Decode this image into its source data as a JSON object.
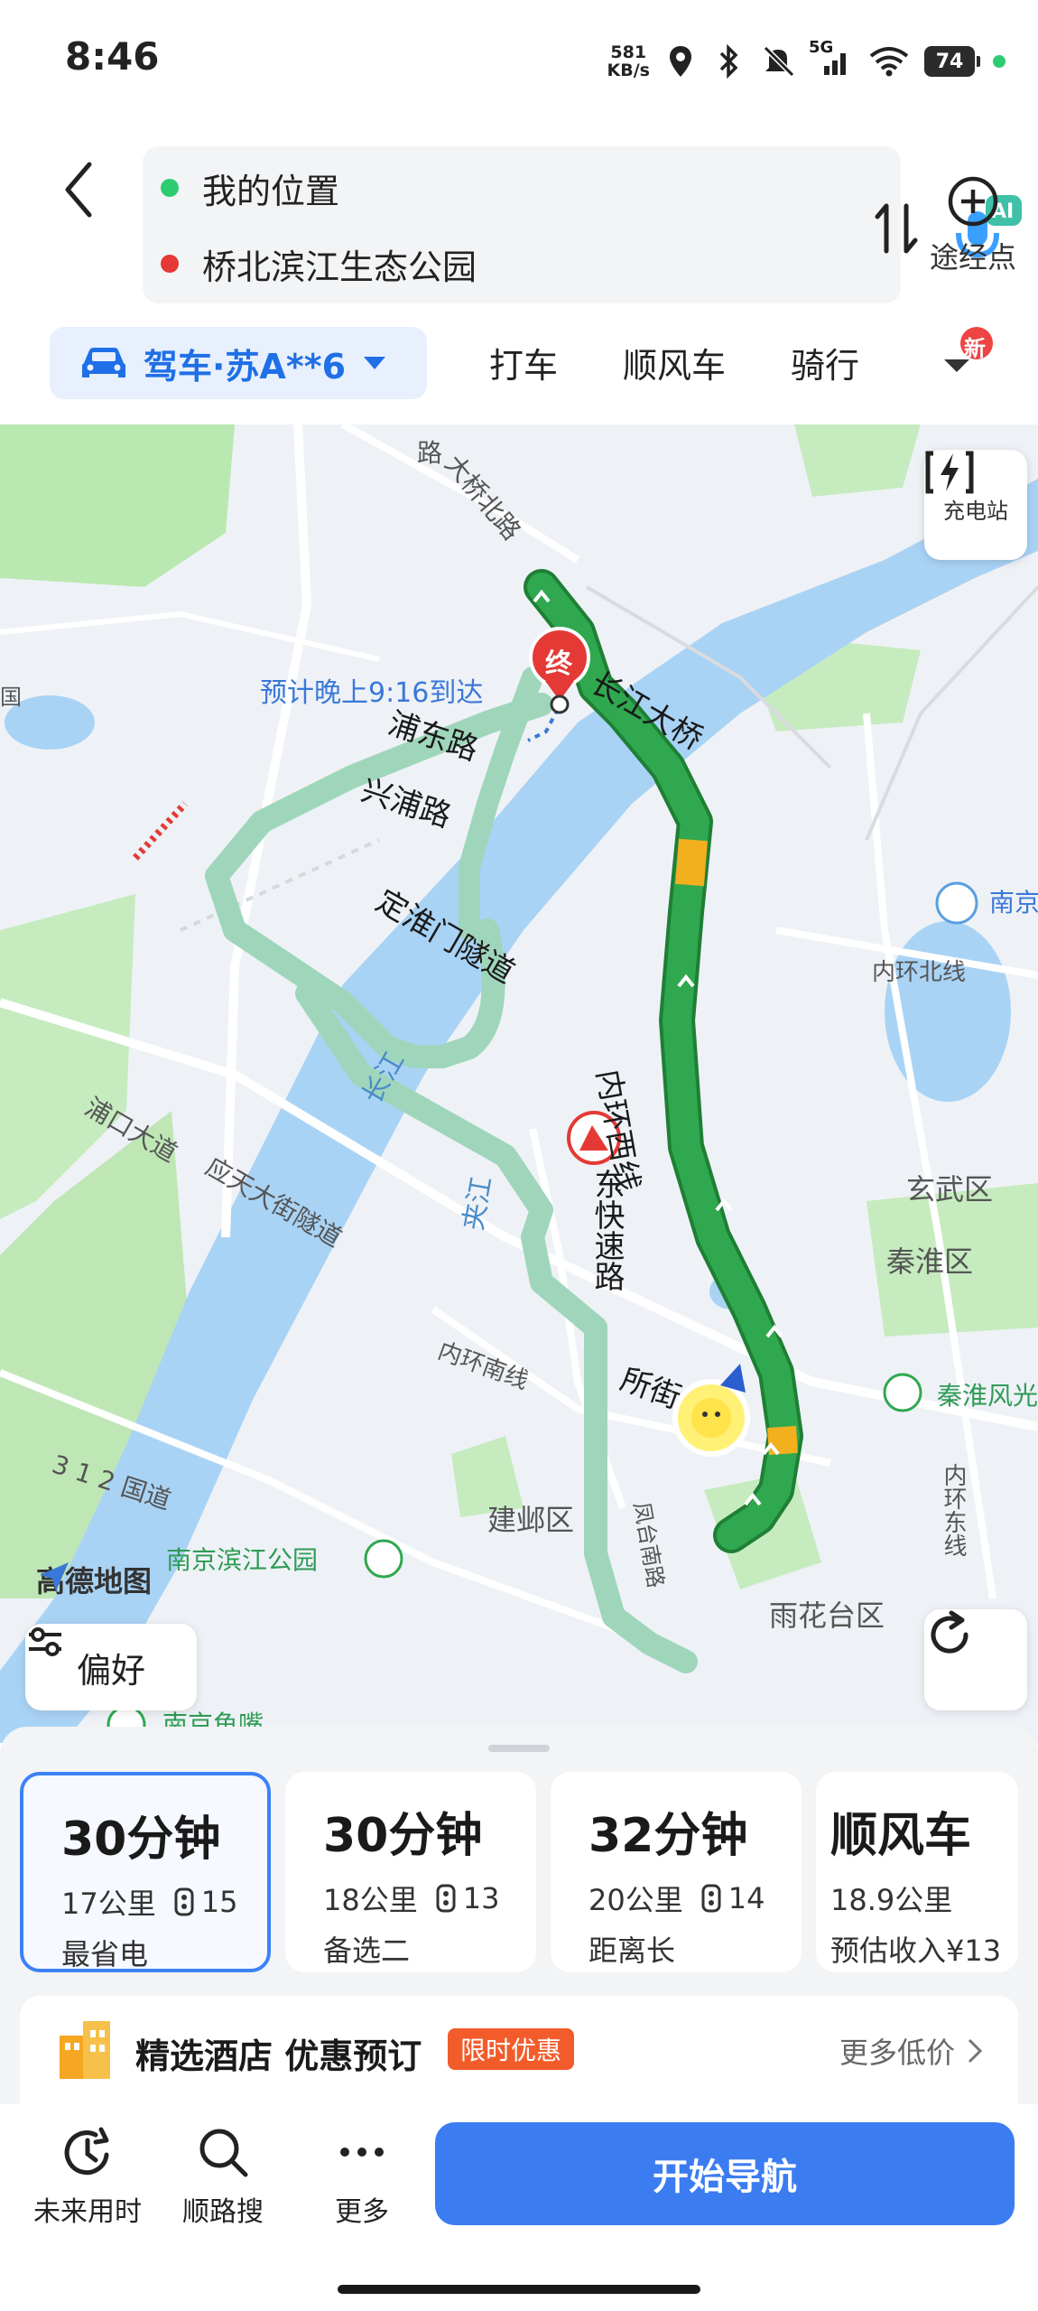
{
  "status_bar": {
    "time": "8:46",
    "net_speed_value": "581",
    "net_speed_unit": "KB/s",
    "network_type": "5G",
    "battery_level": "74",
    "icons": [
      "location-icon",
      "bluetooth-icon",
      "mute-icon",
      "signal-icon",
      "wifi-icon",
      "battery-icon"
    ]
  },
  "route": {
    "start": "我的位置",
    "end": "桥北滨江生态公园",
    "start_color": "#2ecc71",
    "end_color": "#e53935",
    "voice_badge": "AI",
    "waypoint_label": "途经点"
  },
  "modes": {
    "drive_label": "驾车·苏A**6",
    "tabs": [
      "打车",
      "顺风车",
      "骑行"
    ],
    "new_badge": "新",
    "accent": "#1f6fe6"
  },
  "map": {
    "eta": "预计晚上9:16到达",
    "end_marker": "终",
    "charge_label": "充电站",
    "logo": "高德地图",
    "preference_label": "偏好",
    "road_labels": {
      "changjiang_bridge": "长江大桥",
      "neihuan_xixian": "内环西线",
      "dinghuai_tunnel": "定淮门隧道",
      "pudong_road": "浦东路",
      "xingpu_road": "兴浦路",
      "dong_expressway": "东快速路",
      "suo_jie": "所街"
    },
    "place_labels": {
      "daqiao_bei": "大桥北路",
      "lu_top": "路",
      "pukou": "浦口大道",
      "yingtian": "应天大街隧道",
      "changjiang": "长江",
      "jiajiang": "夹江",
      "neihuan_nan": "内环南线",
      "neihuan_bei": "内环北线",
      "neihuan_dong": "内环东线",
      "guodao": "3 1 2 国道",
      "jianye": "建邺区",
      "xuanwu": "玄武区",
      "qinhuai": "秦淮区",
      "yuhuatai": "雨花台区",
      "fengtai": "凤台南路",
      "binjiang_park": "南京滨江公园",
      "yuzui": "南京鱼嘴",
      "qinhuai_scenic": "秦淮风光",
      "nanjing_edge": "南京",
      "left_edge": "国"
    },
    "colors": {
      "route_primary": "#2fa84f",
      "route_alt": "#9fd6bb",
      "water": "#a9d3f5",
      "green": "#b9e8b0"
    }
  },
  "routes": [
    {
      "time": "30分钟",
      "distance": "17公里",
      "lights": "15",
      "tag": "最省电",
      "selected": true
    },
    {
      "time": "30分钟",
      "distance": "18公里",
      "lights": "13",
      "tag": "备选二",
      "selected": false
    },
    {
      "time": "32分钟",
      "distance": "20公里",
      "lights": "14",
      "tag": "距离长",
      "selected": false
    }
  ],
  "carpool": {
    "title": "顺风车",
    "distance": "18.9公里",
    "income": "预估收入¥13"
  },
  "hotel": {
    "title": "精选酒店 优惠预订",
    "badge": "限时优惠",
    "more": "更多低价"
  },
  "toolbar": {
    "future": "未来用时",
    "along": "顺路搜",
    "more": "更多",
    "start_nav": "开始导航"
  }
}
